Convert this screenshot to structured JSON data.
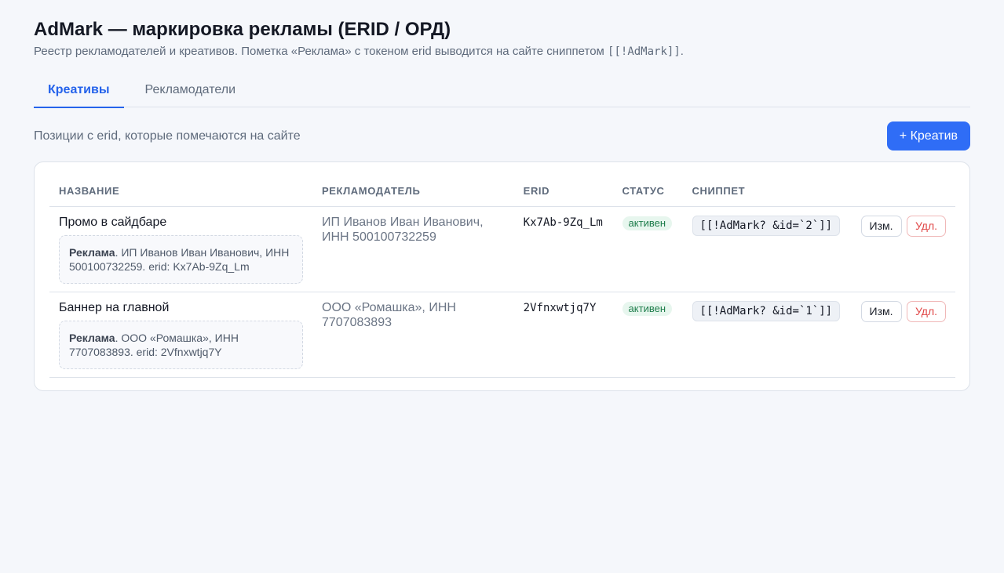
{
  "header": {
    "title": "AdMark — маркировка рекламы (ERID / ОРД)",
    "subtitle_text": "Реестр рекламодателей и креативов. Пометка «Реклама» с токеном erid выводится на сайте сниппетом ",
    "subtitle_code": "[[!AdMark]]",
    "subtitle_end": "."
  },
  "tabs": [
    {
      "label": "Креативы",
      "active": true
    },
    {
      "label": "Рекламодатели",
      "active": false
    }
  ],
  "section": {
    "label": "Позиции с erid, которые помечаются на сайте",
    "add_button": "+ Креатив"
  },
  "table": {
    "columns": [
      "НАЗВАНИЕ",
      "РЕКЛАМОДАТЕЛЬ",
      "ERID",
      "СТАТУС",
      "СНИППЕТ"
    ],
    "rows": [
      {
        "name": "Промо в сайдбаре",
        "preview_bold": "Реклама",
        "preview_text": ". ИП Иванов Иван Иванович, ИНН 500100732259. erid: Kx7Ab-9Zq_Lm",
        "advertiser": "ИП Иванов Иван Иванович, ИНН 500100732259",
        "erid": "Kx7Ab-9Zq_Lm",
        "status": "активен",
        "snippet": "[[!AdMark? &id=`2`]]",
        "edit": "Изм.",
        "delete": "Удл."
      },
      {
        "name": "Баннер на главной",
        "preview_bold": "Реклама",
        "preview_text": ". ООО «Ромашка», ИНН 7707083893. erid: 2Vfnxwtjq7Y",
        "advertiser": "ООО «Ромашка», ИНН 7707083893",
        "erid": "2Vfnxwtjq7Y",
        "status": "активен",
        "snippet": "[[!AdMark? &id=`1`]]",
        "edit": "Изм.",
        "delete": "Удл."
      }
    ]
  },
  "colors": {
    "accent": "#2f6df6",
    "status_active_bg": "#e7f6ee",
    "status_active_text": "#1e7d4b",
    "delete_text": "#e04646"
  }
}
